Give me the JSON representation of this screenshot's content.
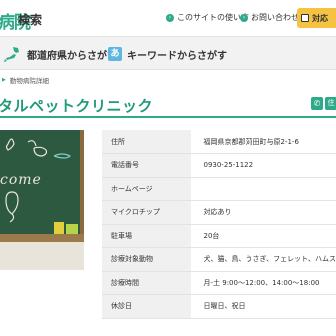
{
  "header": {
    "logo_main": "病院",
    "logo_sub": "検索",
    "links": [
      {
        "label": "このサイトの使い方"
      },
      {
        "label": "お問い合わせ"
      }
    ],
    "cta_label": "対応"
  },
  "search": {
    "by_prefecture": "都道府県からさがす",
    "by_keyword": "キーワードからさがす",
    "keyword_icon_text": "あ"
  },
  "breadcrumb": [
    "動物病院詳細"
  ],
  "page_title": "タルペットクリニック",
  "title_icons": {
    "phone": "phone-icon",
    "address_glyph": "住"
  },
  "photo": {
    "welcome_text": "come"
  },
  "info": [
    {
      "label": "住所",
      "value": "福岡県京都郡苅田町与原2-1-6"
    },
    {
      "label": "電話番号",
      "value": "0930-25-1122"
    },
    {
      "label": "ホームページ",
      "value": ""
    },
    {
      "label": "マイクロチップ",
      "value": "対応あり"
    },
    {
      "label": "駐車場",
      "value": "20台"
    },
    {
      "label": "診療対象動物",
      "value": "犬、猫、鳥、うさぎ、フェレット、ハムス"
    },
    {
      "label": "診療時間",
      "value": "月-土 9:00～12:00、14:00～18:00"
    },
    {
      "label": "休診日",
      "value": "日曜日、祝日"
    }
  ],
  "colors": {
    "accent": "#2eaa8a",
    "cta": "#f5c242",
    "label_bg": "#f0f0f0"
  }
}
